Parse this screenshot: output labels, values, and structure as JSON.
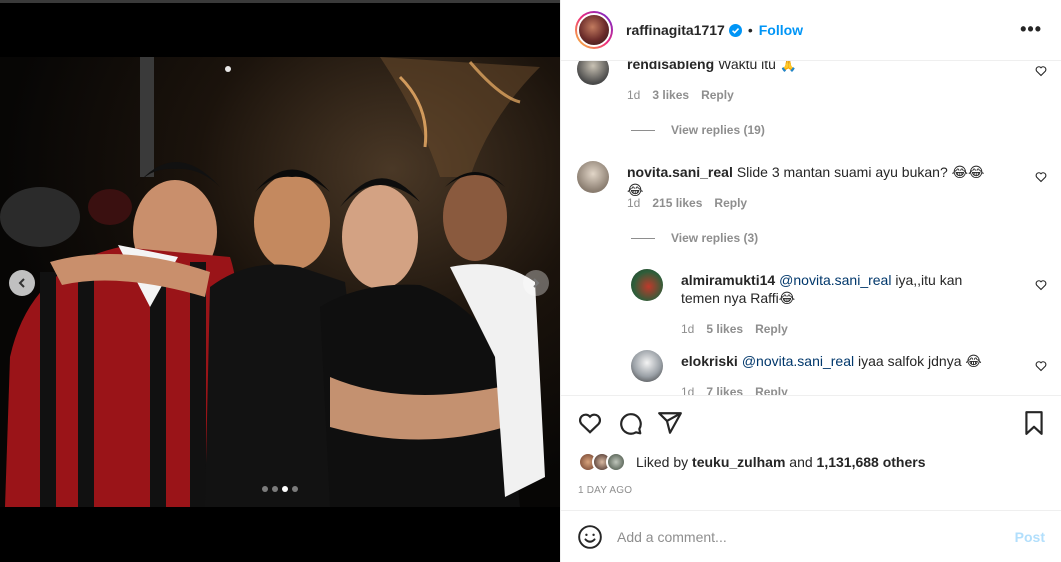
{
  "post": {
    "username": "raffinagita1717",
    "separator": "•",
    "follow_label": "Follow",
    "more_label": "•••",
    "carousel": {
      "slide_count": 4,
      "active_index": 2
    }
  },
  "comments": [
    {
      "user": "rendisableng",
      "text": "Waktu itu 🙏",
      "time": "1d",
      "likes": "3 likes",
      "reply_label": "Reply",
      "view_replies": "View replies (19)"
    },
    {
      "user": "novita.sani_real",
      "text": "Slide 3 mantan suami ayu bukan? 😂😂😂",
      "time": "1d",
      "likes": "215 likes",
      "reply_label": "Reply",
      "view_replies": "View replies (3)"
    }
  ],
  "replies": [
    {
      "user": "almiramukti14",
      "mention": "@novita.sani_real",
      "text": "iya,,itu kan temen nya Raffi😂",
      "time": "1d",
      "likes": "5 likes",
      "reply_label": "Reply"
    },
    {
      "user": "elokriski",
      "mention": "@novita.sani_real",
      "text": "iyaa salfok jdnya 😂",
      "time": "1d",
      "likes": "7 likes",
      "reply_label": "Reply"
    }
  ],
  "likes": {
    "prefix": "Liked by",
    "user": "teuku_zulham",
    "and": "and",
    "others": "1,131,688 others"
  },
  "time_ago": "1 DAY AGO",
  "add_comment": {
    "placeholder": "Add a comment...",
    "post_label": "Post"
  },
  "colors": {
    "link_blue": "#0095f6",
    "mention_blue": "#00376b",
    "muted": "#8e8e8e",
    "post_disabled": "#b2dffc"
  }
}
